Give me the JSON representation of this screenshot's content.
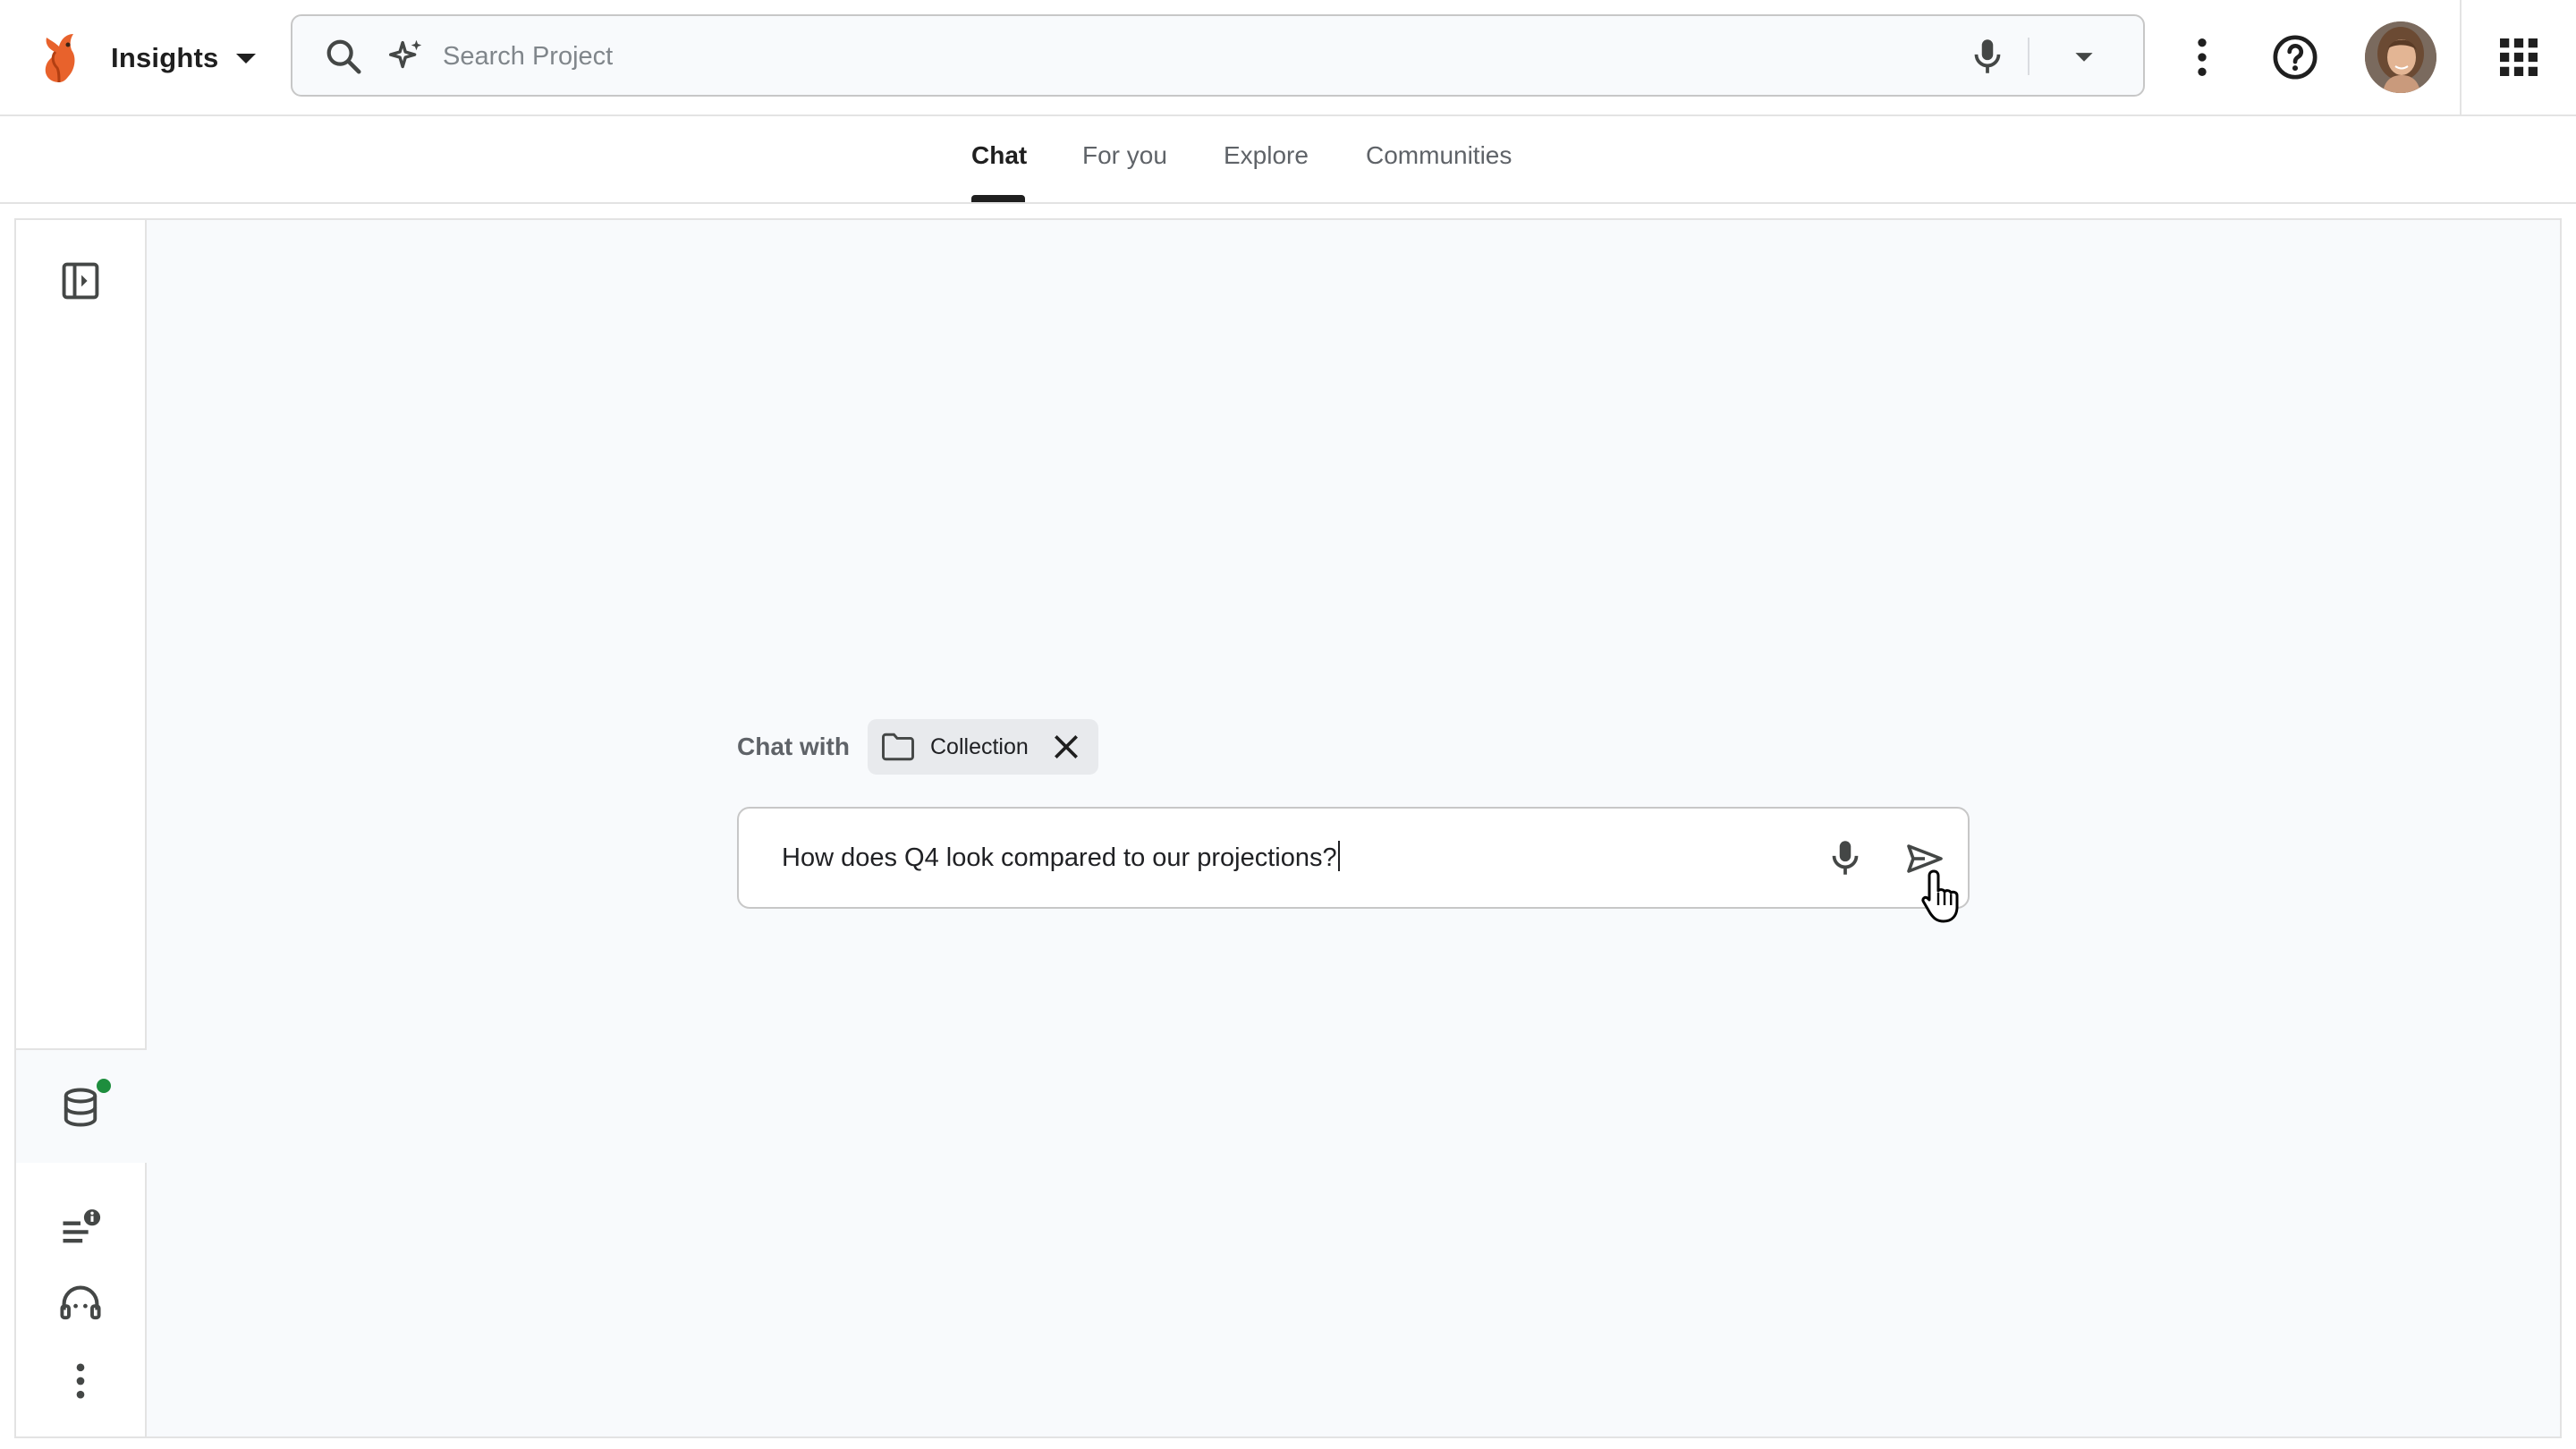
{
  "app": {
    "name": "Insights"
  },
  "search": {
    "placeholder": "Search Project"
  },
  "tabs": [
    {
      "label": "Chat",
      "active": true
    },
    {
      "label": "For you",
      "active": false
    },
    {
      "label": "Explore",
      "active": false
    },
    {
      "label": "Communities",
      "active": false
    }
  ],
  "chat": {
    "context_label": "Chat with",
    "chip_label": "Collection",
    "query": "How does Q4 look compared to our projections?"
  },
  "icons": {
    "logo": "squirrel-logo-icon",
    "search": "search-icon",
    "ai_sparkle": "sparkle-icon",
    "voice": "microphone-icon",
    "search_options": "dropdown-arrow-icon",
    "more": "more-vertical-icon",
    "help": "help-circle-icon",
    "apps": "apps-grid-icon",
    "sidebar_toggle": "sidebar-expand-icon",
    "data": "database-icon",
    "notes": "notes-info-icon",
    "support": "headset-icon",
    "rail_more": "more-vertical-icon",
    "folder": "folder-icon",
    "close": "close-icon",
    "send": "send-icon"
  },
  "colors": {
    "accent_logo": "#e8622c",
    "status_online": "#1e8e3e",
    "canvas": "#f8fafc"
  }
}
